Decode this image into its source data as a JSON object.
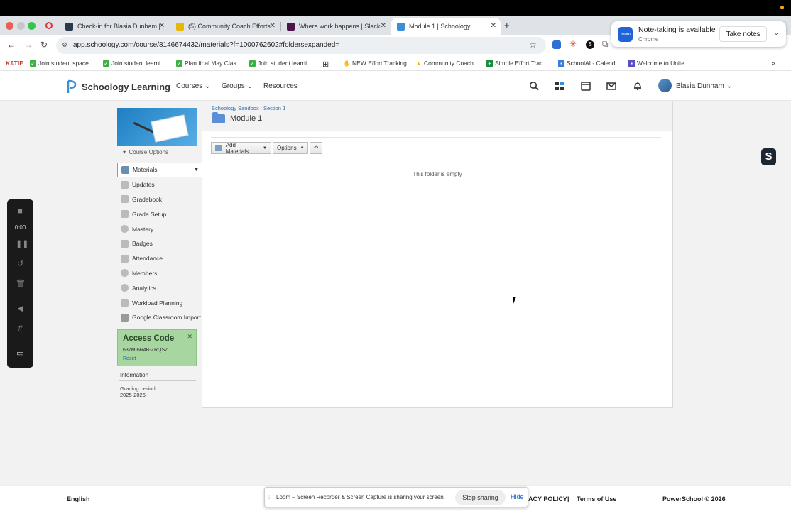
{
  "browser": {
    "tabs": [
      {
        "label": "Check-in for Blasia Dunham |",
        "icon_color": "#2a3a4a"
      },
      {
        "label": "(5) Community Coach Efforts",
        "icon_color": "#e6b800"
      },
      {
        "label": "Where work happens | Slack",
        "icon_color": "#4a154b"
      },
      {
        "label": "Module 1 | Schoology",
        "icon_color": "#3b8fd6"
      }
    ],
    "url": "app.schoology.com/course/8146674432/materials?f=1000762602#foldersexpanded=",
    "bookmarks": [
      {
        "label": "KATIE",
        "type": "text"
      },
      {
        "label": "Join student space...",
        "type": "checked"
      },
      {
        "label": "Join student learni...",
        "type": "checked"
      },
      {
        "label": "Plan final May Clas...",
        "type": "checked"
      },
      {
        "label": "Join student learni...",
        "type": "checked"
      },
      {
        "label": "NEW Effort Tracking",
        "type": "plain"
      },
      {
        "label": "Community Coach...",
        "type": "plain"
      },
      {
        "label": "Simple Effort Trac...",
        "type": "plain"
      },
      {
        "label": "SchoolAI - Calend...",
        "type": "plain"
      },
      {
        "label": "Welcome to Unite...",
        "type": "plain"
      }
    ]
  },
  "zoom_popup": {
    "logo_text": "zoom",
    "title": "Note-taking is available",
    "subtitle": "Chrome",
    "button": "Take notes"
  },
  "header": {
    "logo": "Schoology Learning",
    "nav": [
      "Courses",
      "Groups",
      "Resources"
    ],
    "user": "Blasia Dunham"
  },
  "sidebar": {
    "course_options": "Course Options",
    "items": [
      {
        "label": "Materials"
      },
      {
        "label": "Updates"
      },
      {
        "label": "Gradebook"
      },
      {
        "label": "Grade Setup"
      },
      {
        "label": "Mastery"
      },
      {
        "label": "Badges"
      },
      {
        "label": "Attendance"
      },
      {
        "label": "Members"
      },
      {
        "label": "Analytics"
      },
      {
        "label": "Workload Planning"
      },
      {
        "label": "Google Classroom Import"
      }
    ],
    "access_code": {
      "title": "Access Code",
      "code": "637M-6R4B-ZRQSZ",
      "reset": "Reset"
    },
    "info_title": "Information",
    "grading_label": "Grading period",
    "grading_value": "2025-2026"
  },
  "main": {
    "breadcrumb": "Schoology Sandbox : Section 1",
    "title": "Module 1",
    "add_materials": "Add Materials",
    "options": "Options",
    "empty_text": "This folder is empty"
  },
  "loom_controls": {
    "time": "0:00"
  },
  "footer": {
    "language": "English",
    "privacy": "ACY POLICY",
    "separator": "|",
    "terms": "Terms of Use",
    "copyright": "PowerSchool © 2026"
  },
  "loom_bar": {
    "text": "Loom – Screen Recorder & Screen Capture is sharing your screen.",
    "stop": "Stop sharing",
    "hide": "Hide"
  }
}
